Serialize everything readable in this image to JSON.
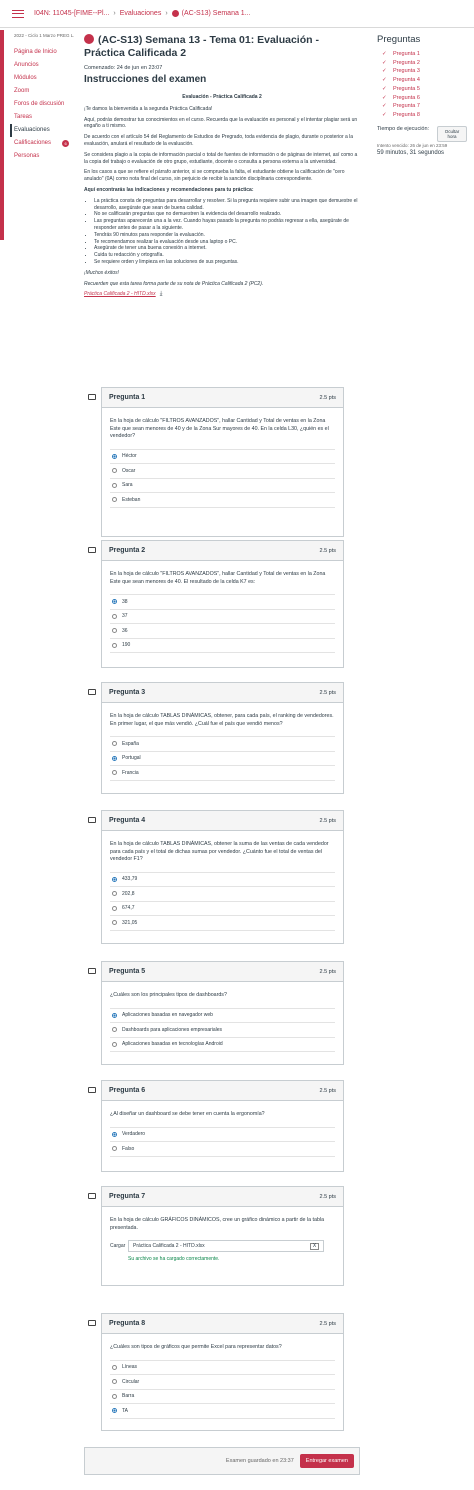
{
  "topbar": {
    "course": "I04N: 11045-[FIME--Pl...",
    "section": "Evaluaciones",
    "current": "(AC-S13) Semana 1..."
  },
  "sidebar": {
    "term": "2022 - Ciclo 1 Marzo PREG L...",
    "items": [
      {
        "label": "Página de Inicio"
      },
      {
        "label": "Anuncios"
      },
      {
        "label": "Módulos"
      },
      {
        "label": "Zoom"
      },
      {
        "label": "Foros de discusión"
      },
      {
        "label": "Tareas"
      },
      {
        "label": "Evaluaciones"
      },
      {
        "label": "Calificaciones",
        "badge": "6"
      },
      {
        "label": "Personas"
      }
    ]
  },
  "quiz": {
    "title": "(AC-S13) Semana 13 - Tema 01: Evaluación - Práctica Calificada 2",
    "started": "Comenzado: 24 de jun en 23:07",
    "instructions_heading": "Instrucciones del examen"
  },
  "instructions": {
    "center_title": "Evaluación - Práctica Calificada 2",
    "p1": "¡Te damos la bienvenida a la segunda Práctica Calificada!",
    "p2": "Aquí, podrás demostrar tus conocimientos en el curso. Recuerda que la evaluación es personal y el intentar plagiar será un engaño a ti mismo.",
    "p3": "De acuerdo con el artículo 54 del Reglamento de Estudios de Pregrado, toda evidencia de plagio, durante o posterior a la evaluación, anulará el resultado de la evaluación.",
    "p4": "Se considera plagio a la copia de información parcial o total de fuentes de información o de páginas de internet, así como a la copia del trabajo o evaluación de otro grupo, estudiante, docente o consulta a persona externa a la universidad.",
    "p5": "En los casos a que se refiere el párrafo anterior, si se comprueba la falta, el estudiante obtiene la calificación de \"cero anulado\" (0A) como nota final del curso, sin perjuicio de recibir la sanción disciplinaria correspondiente.",
    "list_heading": "Aquí encontrarás las indicaciones y recomendaciones para tu práctica:",
    "list": [
      "La práctica consta de preguntas para desarrollar y resolver. Si la pregunta requiere subir una imagen que demuestre el desarrollo, asegúrate que sean de buena calidad.",
      "No se calificarán preguntas que no demuestren la evidencia del desarrollo realizado.",
      "Las preguntas aparecerán una a la vez. Cuando hayas pasado la pregunta no podrás regresar a ella, asegúrate de responder antes de pasar a la siguiente.",
      "Tendrás 90 minutos para responder la evaluación.",
      "Te recomendamos realizar la evaluación desde una laptop o PC.",
      "Asegúrate de tener una buena conexión a internet.",
      "Cuida tu redacción y ortografía.",
      "Se requiere orden y limpieza en las soluciones de sus preguntas."
    ],
    "luck": "¡Muchos éxitos!",
    "reminder": "Recuerden que esta tarea forma parte de su nota de Práctica Calificada 2 (PC2).",
    "file_link": "Práctica Calificada 2 - HITD.xlsx"
  },
  "right": {
    "heading": "Preguntas",
    "questions": [
      "Pregunta 1",
      "Pregunta 2",
      "Pregunta 3",
      "Pregunta 4",
      "Pregunta 5",
      "Pregunta 6",
      "Pregunta 7",
      "Pregunta 8"
    ],
    "timer_label": "Tiempo de ejecución:",
    "hide_button": "Ocultar hora",
    "attempt_due": "Intento vencido: 26 de jun en 23:59",
    "remaining": "59 minutos, 31 segundos"
  },
  "questions": [
    {
      "title": "Pregunta 1",
      "points": "2.5 pts",
      "text": "En la hoja de cálculo \"FILTROS AVANZADOS\", hallar Cantidad y Total de ventas en la Zona Este que sean menores de 40 y de la Zona Sur mayores de 40. En la celda L30, ¿quién es el vendedor?",
      "answers": [
        "Héctor",
        "Oscar",
        "Sara",
        "Esteban"
      ],
      "selected": 0
    },
    {
      "title": "Pregunta 2",
      "points": "2.5 pts",
      "text": "En la hoja de cálculo \"FILTROS AVANZADOS\", hallar Cantidad y Total de ventas en la Zona Este que sean menores de 40. El resultado de la celda K7 es:",
      "answers": [
        "38",
        "37",
        "36",
        "190"
      ],
      "selected": 0
    },
    {
      "title": "Pregunta 3",
      "points": "2.5 pts",
      "text": "En la hoja de cálculo TABLAS DINÁMICAS, obtener, para cada país, el ranking de vendedores. En primer lugar, el que más vendió. ¿Cuál fue el país que vendió menos?",
      "answers": [
        "España",
        "Portugal",
        "Francia"
      ],
      "selected": 1
    },
    {
      "title": "Pregunta 4",
      "points": "2.5 pts",
      "text": "En la hoja de cálculo TABLAS DINÁMICAS, obtener la suma de las ventas de cada vendedor para cada país y el total de dichas sumas por vendedor. ¿Cuánto fue el total de ventas del vendedor F1?",
      "answers": [
        "433,79",
        "202,8",
        "674,7",
        "321,05"
      ],
      "selected": 0
    },
    {
      "title": "Pregunta 5",
      "points": "2.5 pts",
      "text": "¿Cuáles son los principales tipos de dashboards?",
      "answers": [
        "Aplicaciones basadas en navegador web",
        "Dashboards para aplicaciones empresariales",
        "Aplicaciones basadas en tecnologías Android"
      ],
      "selected": 0
    },
    {
      "title": "Pregunta 6",
      "points": "2.5 pts",
      "text": "¿Al diseñar un dashboard se debe tener en cuenta la ergonomía?",
      "answers": [
        "Verdadero",
        "Falso"
      ],
      "selected": 0
    },
    {
      "title": "Pregunta 7",
      "points": "2.5 pts",
      "text": "En la hoja de cálculo GRÁFICOS DINÁMICOS, cree un gráfico dinámico a partir de la tabla presentada.",
      "upload_label": "Cargar",
      "file": "Práctica Calificada 2 - HITD.xlsx",
      "remove": "X",
      "success": "Su archivo se ha cargado correctamente."
    },
    {
      "title": "Pregunta 8",
      "points": "2.5 pts",
      "text": "¿Cuáles son tipos de gráficos que permite Excel para representar datos?",
      "answers": [
        "Líneas",
        "Circular",
        "Barra",
        "TA"
      ],
      "selected": 3
    }
  ],
  "footer": {
    "saved": "Examen guardado en 23:37",
    "submit": "Entregar examen"
  }
}
